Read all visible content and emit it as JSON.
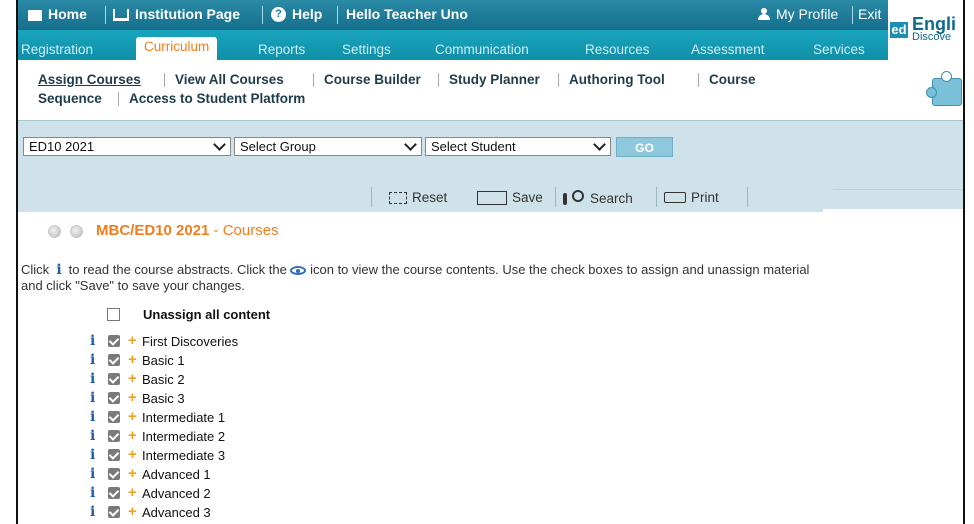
{
  "topbar": {
    "home": "Home",
    "institution": "Institution Page",
    "help": "Help",
    "greeting": "Hello Teacher Uno",
    "profile": "My Profile",
    "exit": "Exit"
  },
  "brand": {
    "logo_mark": "ed",
    "name": "Engli",
    "subtitle": "Discove"
  },
  "tabs": [
    "Registration",
    "Curriculum",
    "Reports",
    "Settings",
    "Communication",
    "Resources",
    "Assessment",
    "Services"
  ],
  "active_tab": "Curriculum",
  "submenu": {
    "assign_courses": "Assign Courses",
    "view_all_courses": "View All Courses",
    "course_builder": "Course Builder",
    "study_planner": "Study Planner",
    "authoring_tool": "Authoring Tool",
    "course_sequence_1": "Course",
    "course_sequence_2": "Sequence",
    "access_student_platform": "Access to Student Platform"
  },
  "selectors": {
    "class": "ED10 2021",
    "group": "Select Group",
    "student": "Select Student",
    "go": "GO"
  },
  "toolbar": {
    "reset": "Reset",
    "save": "Save",
    "search": "Search",
    "print": "Print"
  },
  "page": {
    "title": "MBC/ED10 2021",
    "title_suffix": " - Courses"
  },
  "instructions": {
    "part1": "Click",
    "part2": "to read the course abstracts. Click the",
    "part3": "icon to view the course contents. Use the check boxes to assign and unassign material and click \"Save\" to save your changes."
  },
  "list": {
    "header": "Unassign all content",
    "courses": [
      "First Discoveries",
      "Basic 1",
      "Basic 2",
      "Basic 3",
      "Intermediate 1",
      "Intermediate 2",
      "Intermediate 3",
      "Advanced 1",
      "Advanced 2",
      "Advanced 3"
    ]
  },
  "colors": {
    "topbar": "#146f8c",
    "tabs": "#1aa5bd",
    "accent_orange": "#f07d1a",
    "panel": "#cfe2ea"
  }
}
